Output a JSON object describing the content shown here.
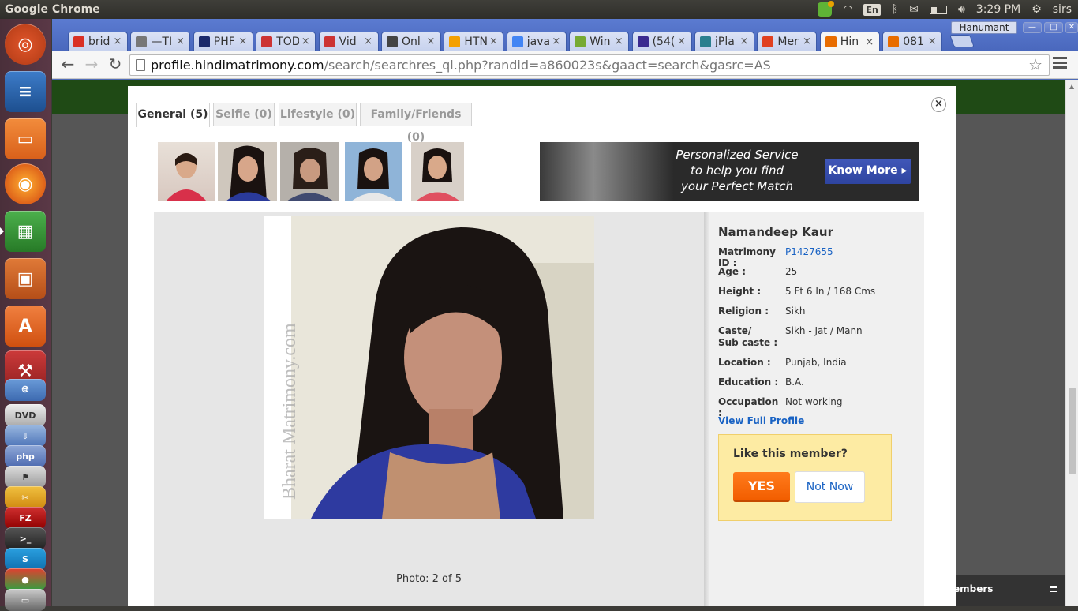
{
  "os_panel": {
    "app_title": "Google Chrome",
    "keyboard_layout": "En",
    "clock": "3:29 PM",
    "user": "sirs"
  },
  "launcher": {
    "items": [
      "ubuntu-dash",
      "libreoffice-writer",
      "files",
      "firefox",
      "libreoffice-calc",
      "libreoffice-impress",
      "software-center",
      "system-settings",
      "network",
      "dvd",
      "php",
      "bookmark",
      "tool",
      "filezilla",
      "terminal",
      "skype",
      "chrome",
      "scanner"
    ]
  },
  "browser": {
    "profile_name": "Hanumant",
    "tabs": [
      {
        "label": "brid",
        "icon": "gmail-icon",
        "color": "#d93025"
      },
      {
        "label": "—TI",
        "icon": "document-icon",
        "color": "#777777"
      },
      {
        "label": "PHF",
        "icon": "php-icon",
        "color": "#1b2a6b"
      },
      {
        "label": "TOD",
        "icon": "lotus-icon",
        "color": "#cc3333"
      },
      {
        "label": "Vid",
        "icon": "lotus-icon",
        "color": "#cc3333"
      },
      {
        "label": "Onl",
        "icon": "owl-icon",
        "color": "#444444"
      },
      {
        "label": "HTN",
        "icon": "stackexchange-icon",
        "color": "#f4a000"
      },
      {
        "label": "java",
        "icon": "google-icon",
        "color": "#4285f4"
      },
      {
        "label": "Win",
        "icon": "ubuntu-one-icon",
        "color": "#77aa33"
      },
      {
        "label": "(54(",
        "icon": "mail-icon",
        "color": "#3a2a8f"
      },
      {
        "label": "jPla",
        "icon": "jplayer-icon",
        "color": "#2a7f8f"
      },
      {
        "label": "Mer",
        "icon": "g-icon",
        "color": "#e04020"
      },
      {
        "label": "Hin",
        "icon": "matrimony-icon",
        "color": "#e86c00",
        "active": true
      },
      {
        "label": "081",
        "icon": "matrimony-icon",
        "color": "#e86c00"
      }
    ],
    "url_host": "profile.hindimatrimony.com",
    "url_path": "/search/searchres_ql.php?randid=a860023s&gaact=search&gasrc=AS"
  },
  "page": {
    "footer_members_label": "embers"
  },
  "modal": {
    "tabs": [
      {
        "label": "General (5)",
        "active": true
      },
      {
        "label": "Selfie (0)"
      },
      {
        "label": "Lifestyle (0)"
      },
      {
        "label": "Family/Friends (0)"
      }
    ],
    "banner": {
      "line1": "Personalized Service",
      "line2": "to help you find",
      "line3": "your Perfect Match",
      "button": "Know More ▸"
    },
    "watermark": "Bharat Matrimony.com",
    "photo_caption": "Photo: 2 of 5",
    "profile": {
      "name": "Namandeep Kaur",
      "fields": [
        {
          "label": "Matrimony ID :",
          "value": "P1427655",
          "link": true
        },
        {
          "label": "Age :",
          "value": "25"
        },
        {
          "label": "Height :",
          "value": "5 Ft 6 In / 168 Cms"
        },
        {
          "label": "Religion :",
          "value": "Sikh"
        },
        {
          "label": "Caste/",
          "label2": "Sub caste :",
          "value": "Sikh - Jat / Mann"
        },
        {
          "label": "Location :",
          "value": "Punjab, India"
        },
        {
          "label": "Education :",
          "value": "B.A."
        },
        {
          "label": "Occupation :",
          "value": "Not working"
        }
      ],
      "view_full_profile": "View Full Profile",
      "like_question": "Like this member?",
      "yes_label": "YES",
      "not_now_label": "Not Now"
    }
  }
}
